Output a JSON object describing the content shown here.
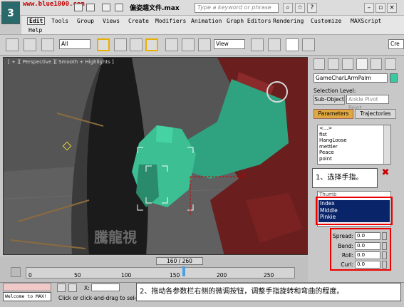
{
  "app": {
    "logo_text": "3",
    "watermark_url": "www.blue1000.com",
    "file_title": "偏姿趨文件.max",
    "search_placeholder": "Type a keyword or phrase"
  },
  "menu": {
    "items": [
      "Edit",
      "Tools",
      "Group",
      "Views",
      "Create",
      "Modifiers",
      "Animation",
      "Graph Editors",
      "Rendering",
      "Customize",
      "MAXScript",
      "Help"
    ]
  },
  "toolbar": {
    "selection_filter": "All",
    "ref_coord": "View",
    "selection_set": "Cre"
  },
  "viewport": {
    "label": "[ + ][ Perspective ][ Smooth + Highlights ]",
    "cn_watermark": "騰龍視",
    "axis_x": "x"
  },
  "panel": {
    "object_name": "GameCharLArmPalm",
    "object_color": "#3cc8a0",
    "selection_level_label": "Selection Level:",
    "subobject_btn": "Sub-Object",
    "subobject_field": "Ankle Pivot Point",
    "tab_parameters": "Parameters",
    "tab_trajectories": "Trajectories",
    "list1": [
      "<...>",
      "fist",
      "HangLoose",
      "mettler",
      "Peace",
      "point"
    ],
    "callout1": "1、选择手指。",
    "list2_header": "Thumb",
    "fingers_selected": [
      "Index",
      "Middle",
      "Pinkie"
    ],
    "spinners": [
      {
        "label": "Spread:",
        "value": "0.0"
      },
      {
        "label": "Bend:",
        "value": "0.0"
      },
      {
        "label": "Roll:",
        "value": "0.0"
      },
      {
        "label": "Curl:",
        "value": "0.0"
      }
    ]
  },
  "timeline": {
    "slider": "160 / 260",
    "ticks": [
      "0",
      "50",
      "100",
      "150",
      "200",
      "250"
    ]
  },
  "status": {
    "maxscript": "Welcome to MAX!",
    "coord_x": "X:",
    "prompt": "Click or click-and-drag to select",
    "callout2": "2、拖动各参数栏右侧的微调按钮，调整手指旋转和弯曲的程度。"
  }
}
